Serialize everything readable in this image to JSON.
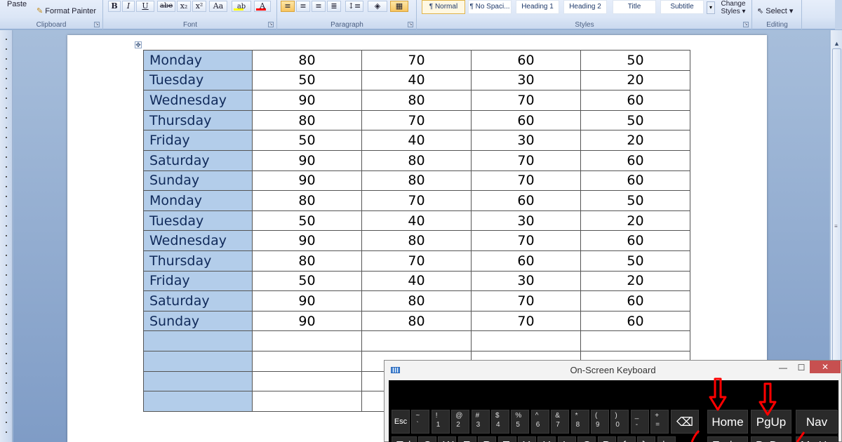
{
  "ribbon": {
    "clipboard": {
      "paste_label": "Paste",
      "format_painter_label": "Format Painter",
      "group_label": "Clipboard"
    },
    "font": {
      "group_label": "Font",
      "buttons": [
        "B",
        "I",
        "U",
        "abe",
        "x₂",
        "x²",
        "Aa"
      ],
      "highlight_color": "#ffff00",
      "font_color": "#ff0000"
    },
    "paragraph": {
      "group_label": "Paragraph"
    },
    "styles": {
      "group_label": "Styles",
      "items": [
        "¶ Normal",
        "¶ No Spaci...",
        "Heading 1",
        "Heading 2",
        "Title",
        "Subtitle"
      ],
      "change_styles_line1": "Change",
      "change_styles_line2": "Styles"
    },
    "editing": {
      "group_label": "Editing",
      "select_label": "Select"
    }
  },
  "document": {
    "table_rows": [
      [
        "Monday",
        "80",
        "70",
        "60",
        "50"
      ],
      [
        "Tuesday",
        "50",
        "40",
        "30",
        "20"
      ],
      [
        "Wednesday",
        "90",
        "80",
        "70",
        "60"
      ],
      [
        "Thursday",
        "80",
        "70",
        "60",
        "50"
      ],
      [
        "Friday",
        "50",
        "40",
        "30",
        "20"
      ],
      [
        "Saturday",
        "90",
        "80",
        "70",
        "60"
      ],
      [
        "Sunday",
        "90",
        "80",
        "70",
        "60"
      ],
      [
        "Monday",
        "80",
        "70",
        "60",
        "50"
      ],
      [
        "Tuesday",
        "50",
        "40",
        "30",
        "20"
      ],
      [
        "Wednesday",
        "90",
        "80",
        "70",
        "60"
      ],
      [
        "Thursday",
        "80",
        "70",
        "60",
        "50"
      ],
      [
        "Friday",
        "50",
        "40",
        "30",
        "20"
      ],
      [
        "Saturday",
        "90",
        "80",
        "70",
        "60"
      ],
      [
        "Sunday",
        "90",
        "80",
        "70",
        "60"
      ],
      [
        "",
        "",
        "",
        "",
        ""
      ],
      [
        "",
        "",
        "",
        "",
        ""
      ],
      [
        "",
        "",
        "",
        "",
        ""
      ],
      [
        "",
        "",
        "",
        "",
        ""
      ]
    ],
    "first_column_color": "#b3cdea"
  },
  "osk": {
    "title": "On-Screen Keyboard",
    "minimize_label": "—",
    "maximize_label": "☐",
    "close_label": "✕",
    "number_row": [
      {
        "main": "Esc"
      },
      {
        "top": "~",
        "bot": "`"
      },
      {
        "top": "!",
        "bot": "1"
      },
      {
        "top": "@",
        "bot": "2"
      },
      {
        "top": "#",
        "bot": "3"
      },
      {
        "top": "$",
        "bot": "4"
      },
      {
        "top": "%",
        "bot": "5"
      },
      {
        "top": "^",
        "bot": "6"
      },
      {
        "top": "&",
        "bot": "7"
      },
      {
        "top": "*",
        "bot": "8"
      },
      {
        "top": "(",
        "bot": "9"
      },
      {
        "top": ")",
        "bot": "0"
      },
      {
        "top": "_",
        "bot": "-"
      },
      {
        "top": "+",
        "bot": "="
      }
    ],
    "backspace_icon": "⌫",
    "nav_keys": [
      "Home",
      "PgUp",
      "Nav"
    ],
    "letter_row": [
      "Tab",
      "Q",
      "W",
      "E",
      "R",
      "T",
      "Y",
      "U",
      "I",
      "O",
      "P",
      "{",
      "}",
      "|"
    ],
    "lower_nav_keys": [
      "End",
      "PgDn",
      "Mv Up"
    ],
    "annotation_color": "#ff0000"
  }
}
